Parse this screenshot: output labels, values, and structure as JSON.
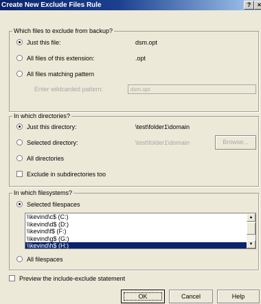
{
  "window": {
    "title": "Create New Exclude Files Rule",
    "help_glyph": "?",
    "close_glyph": "×"
  },
  "files": {
    "legend": "Which files to exclude from backup?",
    "just_this_file_label": "Just this file:",
    "just_this_file_value": "dsm.opt",
    "extension_label": "All files of this extension:",
    "extension_value": ".opt",
    "pattern_label": "All files matching pattern",
    "wildcard_label": "Enter wildcarded pattern:",
    "wildcard_value": "dsm.opt",
    "selected": "just_this_file"
  },
  "dirs": {
    "legend": "In which directories?",
    "just_this_dir_label": "Just this directory:",
    "just_this_dir_value": "\\test\\folder1\\domain",
    "selected_dir_label": "Selected directory:",
    "selected_dir_value": "\\test\\folder1\\domain",
    "browse_label": "Browse...",
    "all_dirs_label": "All directories",
    "subdirs_label": "Exclude in subdirectories too",
    "selected": "just_this_dir",
    "subdirs_checked": false
  },
  "fs": {
    "legend": "In which filesystems?",
    "selected_fs_label": "Selected filespaces",
    "items": [
      "\\\\kevind\\c$ (C:)",
      "\\\\kevind\\d$ (D:)",
      "\\\\kevind\\f$ (F:)",
      "\\\\kevind\\g$ (G:)",
      "\\\\kevind\\h$ (H:)"
    ],
    "selected_index": 4,
    "all_fs_label": "All filespaces",
    "selected": "selected_filespaces"
  },
  "preview": {
    "label": "Preview the include-exclude statement",
    "checked": false
  },
  "buttons": {
    "ok": "OK",
    "cancel": "Cancel",
    "help": "Help"
  }
}
